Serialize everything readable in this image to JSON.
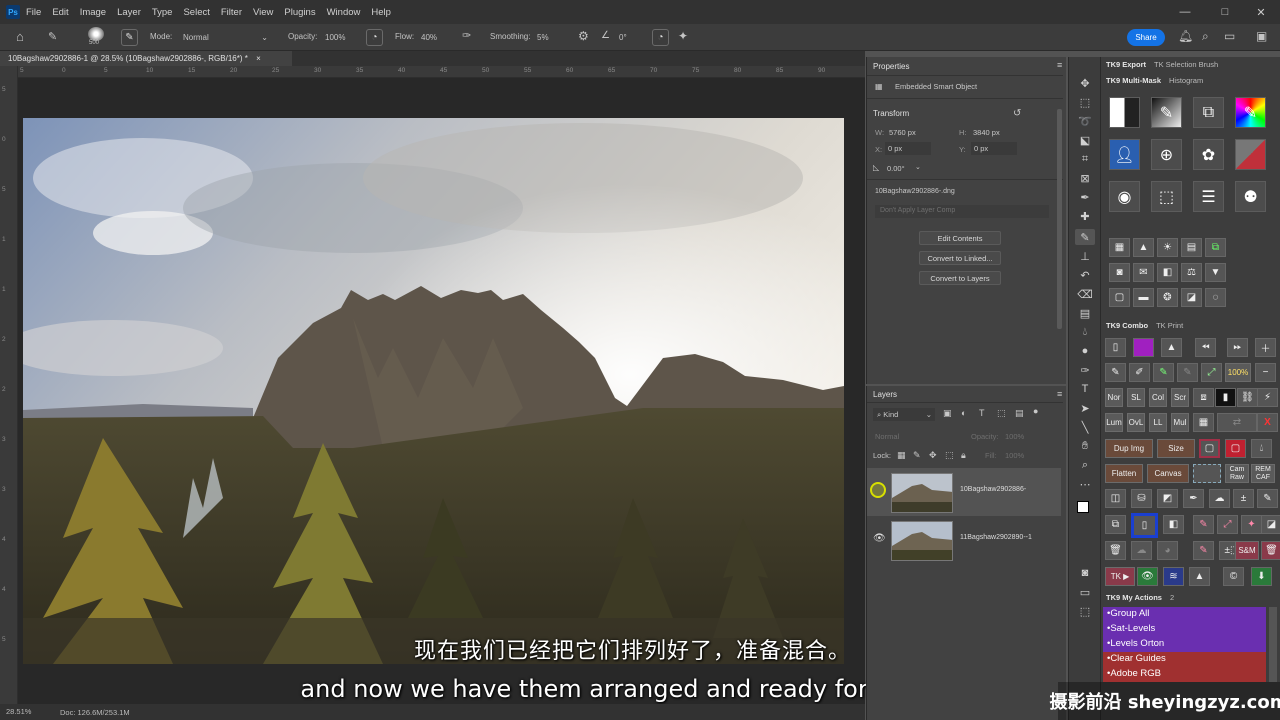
{
  "app": {
    "logo": "Ps",
    "menu": [
      "File",
      "Edit",
      "Image",
      "Layer",
      "Type",
      "Select",
      "Filter",
      "View",
      "Plugins",
      "Window",
      "Help"
    ],
    "window_controls": [
      "—",
      "□",
      "✕"
    ]
  },
  "options_bar": {
    "brush_size": "500",
    "mode_label": "Mode:",
    "mode_value": "Normal",
    "opacity_label": "Opacity:",
    "opacity_value": "100%",
    "flow_label": "Flow:",
    "flow_value": "40%",
    "smoothing_label": "Smoothing:",
    "smoothing_value": "5%",
    "angle_value": "0°",
    "share_label": "Share"
  },
  "document": {
    "tab_title": "10Bagshaw2902886-1 @ 28.5% (10Bagshaw2902886-, RGB/16*) *",
    "zoom": "28.51%",
    "doc_info": "Doc: 126.6M/253.1M"
  },
  "ruler": {
    "h_ticks": [
      "5",
      "0",
      "5",
      "10",
      "15",
      "20",
      "25",
      "30",
      "35",
      "40",
      "45",
      "50",
      "55",
      "60",
      "65",
      "70",
      "75",
      "80",
      "85",
      "90"
    ],
    "v_ticks": [
      "5",
      "0",
      "5",
      "1",
      "1",
      "2",
      "2",
      "3",
      "3",
      "4",
      "4",
      "5"
    ]
  },
  "properties": {
    "title": "Properties",
    "kind": "Embedded Smart Object",
    "section": "Transform",
    "w_label": "W:",
    "w_value": "5760 px",
    "h_label": "H:",
    "h_value": "3840 px",
    "x_label": "X:",
    "x_value": "0 px",
    "y_label": "Y:",
    "y_value": "0 px",
    "angle_value": "0.00°",
    "source_file": "10Bagshaw2902886-.dng",
    "layer_comp": "Don't Apply Layer Comp",
    "buttons": [
      "Edit Contents",
      "Convert to Linked...",
      "Convert to Layers"
    ]
  },
  "layers": {
    "title": "Layers",
    "filter_kind": "Kind",
    "blend_mode": "Normal",
    "opacity_label": "Opacity:",
    "opacity_value": "100%",
    "lock_label": "Lock:",
    "fill_label": "Fill:",
    "fill_value": "100%",
    "items": [
      {
        "name": "10Bagshaw2902886-"
      },
      {
        "name": "11Bagshaw2902890--1"
      }
    ]
  },
  "tk_panel": {
    "tabs_top": [
      "TK9 Export",
      "TK Selection Brush"
    ],
    "tabs_mid": [
      "TK9 Multi-Mask",
      "Histogram"
    ],
    "tabs_combo": [
      "TK9 Combo",
      "TK Print"
    ],
    "zoom_btn": "100%",
    "blend_row": [
      "Nor",
      "SL",
      "Col",
      "Scr"
    ],
    "blend_row2": [
      "Lum",
      "OvL",
      "LL",
      "Mul"
    ],
    "text_row1": [
      "Dup Img",
      "Size"
    ],
    "text_row2": [
      "Flatten",
      "Canvas"
    ],
    "cam_raw": "Cam Raw",
    "rem_caf": "REM CAF",
    "sm_btn": "S&M",
    "tk_btn": "TK ▶",
    "actions_title": "TK9 My Actions",
    "actions_count": "2",
    "actions": [
      "•Group All",
      "•Sat-Levels",
      "•Levels Orton",
      "•Clear Guides",
      "•Adobe RGB"
    ],
    "colors": {
      "purple": "#6a2fb0",
      "red_action": "#a03030",
      "accent_blue": "#1a3fd0"
    }
  },
  "subtitles": {
    "zh": "现在我们已经把它们排列好了，准备混合。",
    "en": "and now we have them arranged and ready for blending"
  },
  "watermark": "摄影前沿 sheyingzyz.com"
}
